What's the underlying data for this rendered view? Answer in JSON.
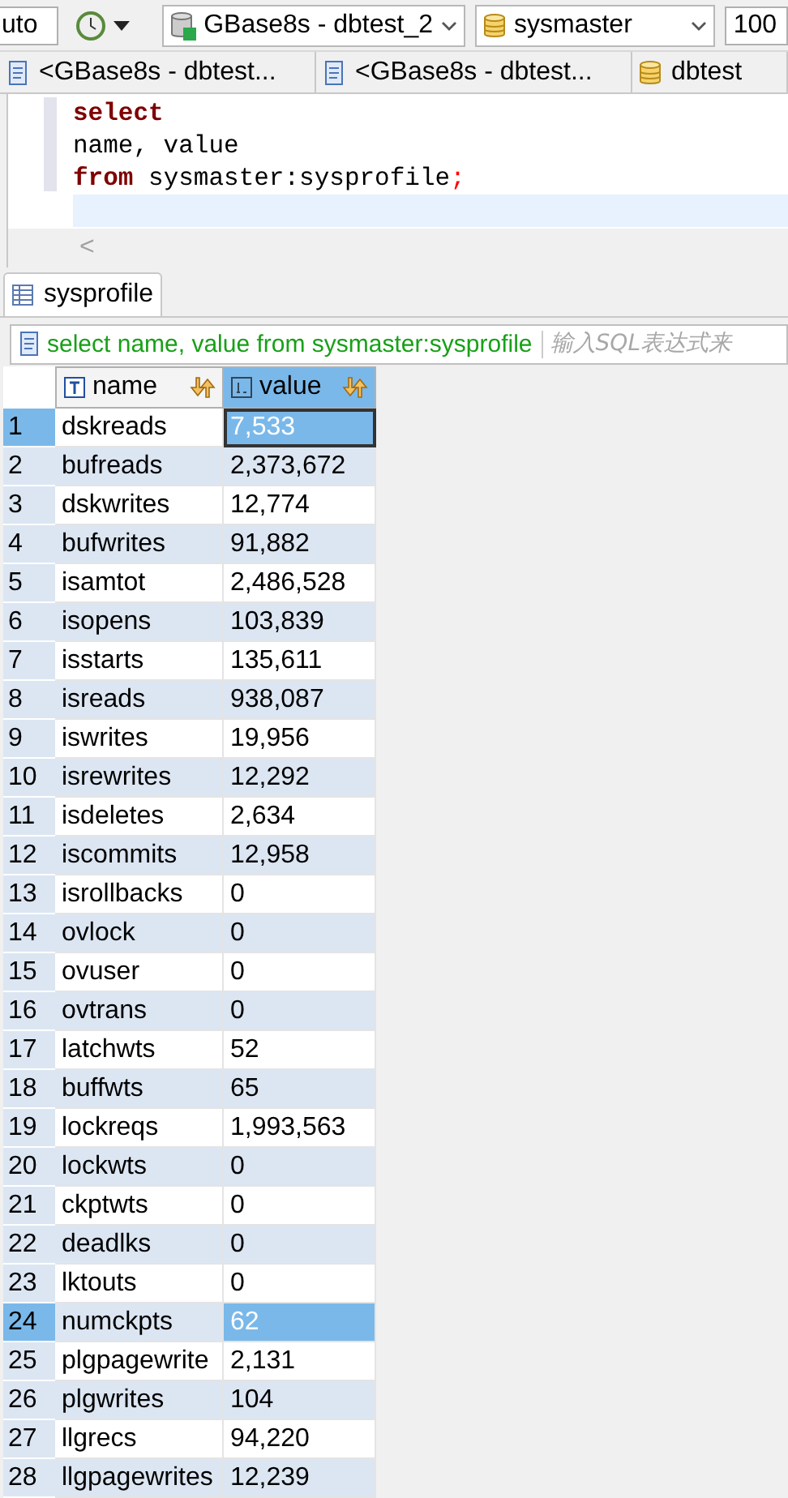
{
  "toolbar": {
    "mode_field": "uto",
    "connection": "GBase8s - dbtest_2",
    "database": "sysmaster",
    "limit_field": "100"
  },
  "tabs": [
    {
      "label": "<GBase8s - dbtest...",
      "kind": "script",
      "selected": false
    },
    {
      "label": "<GBase8s - dbtest...",
      "kind": "script",
      "selected": false
    },
    {
      "label": "dbtest",
      "kind": "database",
      "selected": false
    }
  ],
  "editor": {
    "lines": [
      [
        {
          "text": "select",
          "kind": "keyword"
        }
      ],
      [
        {
          "text": "name, value",
          "kind": "plain"
        }
      ],
      [
        {
          "text": "from",
          "kind": "keyword"
        },
        {
          "text": " sysmaster:sysprofile",
          "kind": "plain"
        },
        {
          "text": ";",
          "kind": "punct"
        }
      ]
    ],
    "scroll_left": "<"
  },
  "result_tab": {
    "label": "sysprofile",
    "selected": true
  },
  "filter": {
    "query": "select name, value from sysmaster:sysprofile",
    "placeholder": "输入SQL表达式来"
  },
  "table": {
    "columns": [
      {
        "label": "name",
        "kind": "text",
        "selected": false
      },
      {
        "label": "value",
        "kind": "number",
        "selected": true
      }
    ],
    "rows": [
      {
        "n": "1",
        "name": "dskreads",
        "value": "7,533",
        "selected": true,
        "focused": true
      },
      {
        "n": "2",
        "name": "bufreads",
        "value": "2,373,672",
        "selected": false,
        "focused": false
      },
      {
        "n": "3",
        "name": "dskwrites",
        "value": "12,774",
        "selected": false,
        "focused": false
      },
      {
        "n": "4",
        "name": "bufwrites",
        "value": "91,882",
        "selected": false,
        "focused": false
      },
      {
        "n": "5",
        "name": "isamtot",
        "value": "2,486,528",
        "selected": false,
        "focused": false
      },
      {
        "n": "6",
        "name": "isopens",
        "value": "103,839",
        "selected": false,
        "focused": false
      },
      {
        "n": "7",
        "name": "isstarts",
        "value": "135,611",
        "selected": false,
        "focused": false
      },
      {
        "n": "8",
        "name": "isreads",
        "value": "938,087",
        "selected": false,
        "focused": false
      },
      {
        "n": "9",
        "name": "iswrites",
        "value": "19,956",
        "selected": false,
        "focused": false
      },
      {
        "n": "10",
        "name": "isrewrites",
        "value": "12,292",
        "selected": false,
        "focused": false
      },
      {
        "n": "11",
        "name": "isdeletes",
        "value": "2,634",
        "selected": false,
        "focused": false
      },
      {
        "n": "12",
        "name": "iscommits",
        "value": "12,958",
        "selected": false,
        "focused": false
      },
      {
        "n": "13",
        "name": "isrollbacks",
        "value": "0",
        "selected": false,
        "focused": false
      },
      {
        "n": "14",
        "name": "ovlock",
        "value": "0",
        "selected": false,
        "focused": false
      },
      {
        "n": "15",
        "name": "ovuser",
        "value": "0",
        "selected": false,
        "focused": false
      },
      {
        "n": "16",
        "name": "ovtrans",
        "value": "0",
        "selected": false,
        "focused": false
      },
      {
        "n": "17",
        "name": "latchwts",
        "value": "52",
        "selected": false,
        "focused": false
      },
      {
        "n": "18",
        "name": "buffwts",
        "value": "65",
        "selected": false,
        "focused": false
      },
      {
        "n": "19",
        "name": "lockreqs",
        "value": "1,993,563",
        "selected": false,
        "focused": false
      },
      {
        "n": "20",
        "name": "lockwts",
        "value": "0",
        "selected": false,
        "focused": false
      },
      {
        "n": "21",
        "name": "ckptwts",
        "value": "0",
        "selected": false,
        "focused": false
      },
      {
        "n": "22",
        "name": "deadlks",
        "value": "0",
        "selected": false,
        "focused": false
      },
      {
        "n": "23",
        "name": "lktouts",
        "value": "0",
        "selected": false,
        "focused": false
      },
      {
        "n": "24",
        "name": "numckpts",
        "value": "62",
        "selected": true,
        "focused": false
      },
      {
        "n": "25",
        "name": "plgpagewrite",
        "value": "2,131",
        "selected": false,
        "focused": false
      },
      {
        "n": "26",
        "name": "plgwrites",
        "value": "104",
        "selected": false,
        "focused": false
      },
      {
        "n": "27",
        "name": "llgrecs",
        "value": "94,220",
        "selected": false,
        "focused": false
      },
      {
        "n": "28",
        "name": "llgpagewrites",
        "value": "12,239",
        "selected": false,
        "focused": false
      }
    ]
  }
}
